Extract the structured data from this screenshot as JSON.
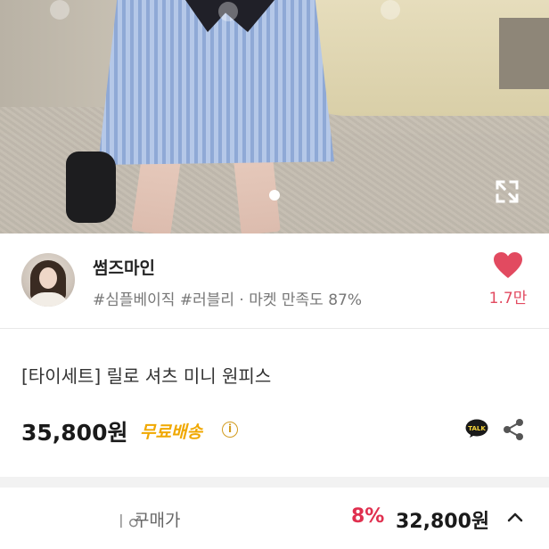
{
  "product_photo": {
    "alt": "",
    "page_indicator": "current",
    "expand_icon": "expand-icon"
  },
  "seller": {
    "name": "썸즈마인",
    "tags": "#심플베이직 #러블리 · 마켓 만족도 87%",
    "like_count": "1.7만",
    "like_icon": "heart-icon",
    "colors": {
      "heart": "#e24a60"
    }
  },
  "product": {
    "title": "[타이세트] 릴로 셔츠 미니 원피스",
    "price": "35,800원",
    "shipping": "무료배송",
    "info_icon": "i",
    "talk_icon": "kakaotalk-icon",
    "share_icon": "share-icon",
    "colors": {
      "shipping": "#f0a800"
    }
  },
  "buybar": {
    "label_prefix": "ㅣ♂",
    "label": "구매가",
    "discount": "8%",
    "final_price": "32,800원",
    "chevron": "chevron-up-icon",
    "colors": {
      "discount": "#e0304f"
    }
  }
}
